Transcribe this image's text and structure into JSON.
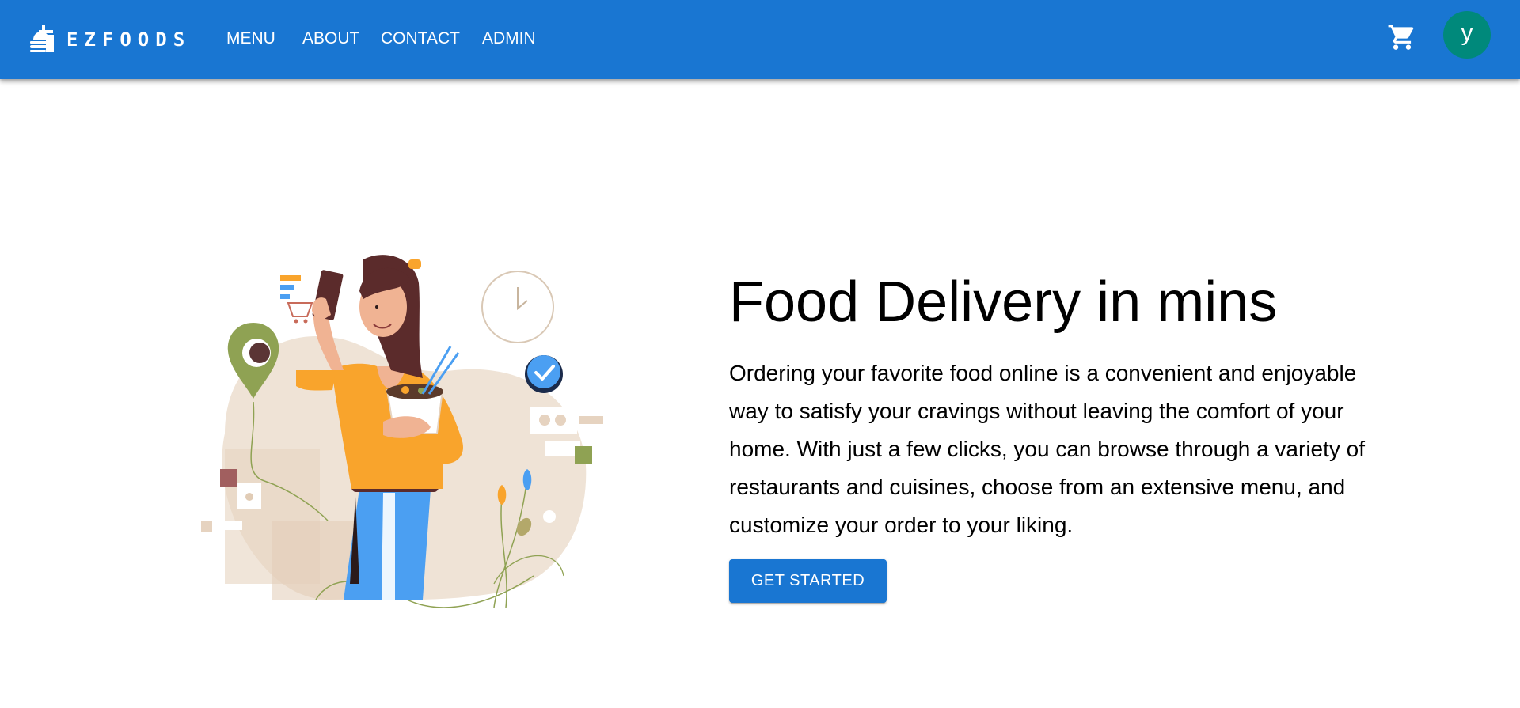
{
  "header": {
    "brand": "EZFOODS",
    "nav": [
      "MENU",
      "ABOUT",
      "CONTACT",
      "ADMIN"
    ],
    "cart_icon": "shopping-cart-icon",
    "avatar_letter": "y"
  },
  "hero": {
    "title": "Food Delivery in mins",
    "description_lines": [
      "Ordering your favorite food online is a convenient and enjoyable",
      "way to satisfy your cravings without leaving the comfort of your",
      "home. With just a few clicks, you can browse through a variety of",
      "restaurants and cuisines, choose from an extensive menu, and",
      "customize your order to your liking."
    ],
    "cta": "GET STARTED"
  },
  "colors": {
    "primary": "#1976d2",
    "avatar": "#00897b",
    "accent_orange": "#f9a42c",
    "accent_blue": "#4b9ff2",
    "accent_green": "#8fa253"
  }
}
